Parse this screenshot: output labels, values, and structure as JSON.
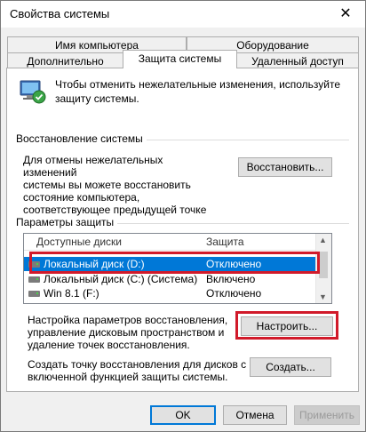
{
  "window": {
    "title": "Свойства системы",
    "close_glyph": "✕"
  },
  "tabs_top": [
    {
      "label": "Имя компьютера"
    },
    {
      "label": "Оборудование"
    }
  ],
  "tabs_bottom": [
    {
      "label": "Дополнительно"
    },
    {
      "label": "Защита системы",
      "active": true
    },
    {
      "label": "Удаленный доступ"
    }
  ],
  "intro": {
    "icon": "system-protection-icon",
    "text_line1": "Чтобы отменить нежелательные изменения, используйте",
    "text_line2": "защиту системы."
  },
  "restore": {
    "group_label": "Восстановление системы",
    "desc_lines": [
      "Для отмены нежелательных изменений",
      "системы вы можете восстановить",
      "состояние компьютера,",
      "соответствующее предыдущей точке",
      "восстановления."
    ],
    "button_label": "Восстановить..."
  },
  "protection": {
    "group_label": "Параметры защиты",
    "columns": [
      "Доступные диски",
      "Защита"
    ],
    "rows": [
      {
        "name": "Локальный диск (D:)",
        "status": "Отключено",
        "selected": true
      },
      {
        "name": "Локальный диск (C:) (Система)",
        "status": "Включено",
        "selected": false
      },
      {
        "name": "Win 8.1 (F:)",
        "status": "Отключено",
        "selected": false
      }
    ]
  },
  "configure": {
    "desc_lines": [
      "Настройка параметров восстановления,",
      "управление дисковым пространством и",
      "удаление точек восстановления."
    ],
    "button_label": "Настроить..."
  },
  "create": {
    "desc_lines": [
      "Создать точку восстановления для дисков с",
      "включенной функцией защиты системы."
    ],
    "button_label": "Создать..."
  },
  "footer": {
    "ok": "OK",
    "cancel": "Отмена",
    "apply": "Применить"
  },
  "colors": {
    "highlight": "#0078d7",
    "annotation_red": "#d11a2a"
  }
}
